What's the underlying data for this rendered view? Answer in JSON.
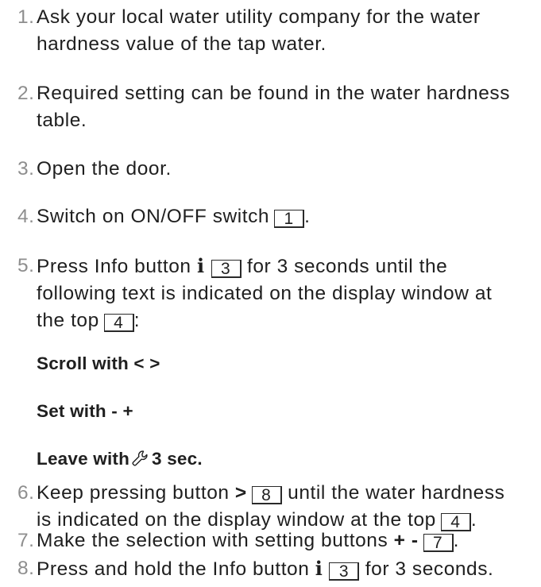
{
  "steps": [
    {
      "num": "1.",
      "lines": [
        "Ask your local water utility company for the water",
        "hardness value of the tap water."
      ]
    },
    {
      "num": "2.",
      "lines": [
        "Required setting can be found in the water hardness",
        "table."
      ]
    },
    {
      "num": "3.",
      "lines": [
        "Open the door."
      ]
    },
    {
      "num": "4.",
      "pre": "Switch on ON/OFF switch",
      "box": "1",
      "post": "."
    },
    {
      "num": "5.",
      "pre": "Press Info button",
      "info_symbol": "i",
      "box": "3",
      "post": "for 3 seconds until the",
      "line2": "following text is indicated on the display window at",
      "line3_pre": "the top",
      "line3_box": "4",
      "line3_post": ":"
    },
    {
      "num": "6.",
      "pre": "Keep pressing button",
      "sym": ">",
      "box": "8",
      "post": "until the water hardness",
      "line2_pre": "is indicated on the display window at the top",
      "line2_box": "4",
      "line2_post": "."
    },
    {
      "num": "7.",
      "pre": "Make the selection with setting buttons",
      "sym": "+ -",
      "box": "7",
      "post": "."
    },
    {
      "num": "8.",
      "pre": "Press and hold the Info button",
      "info_symbol": "i",
      "box": "3",
      "post": "for 3 seconds."
    }
  ],
  "display_text": {
    "scroll": "Scroll with < >",
    "set": "Set with - +",
    "leave_pre": "Leave with",
    "leave_icon": "wrench-icon",
    "leave_post": "3 sec."
  }
}
